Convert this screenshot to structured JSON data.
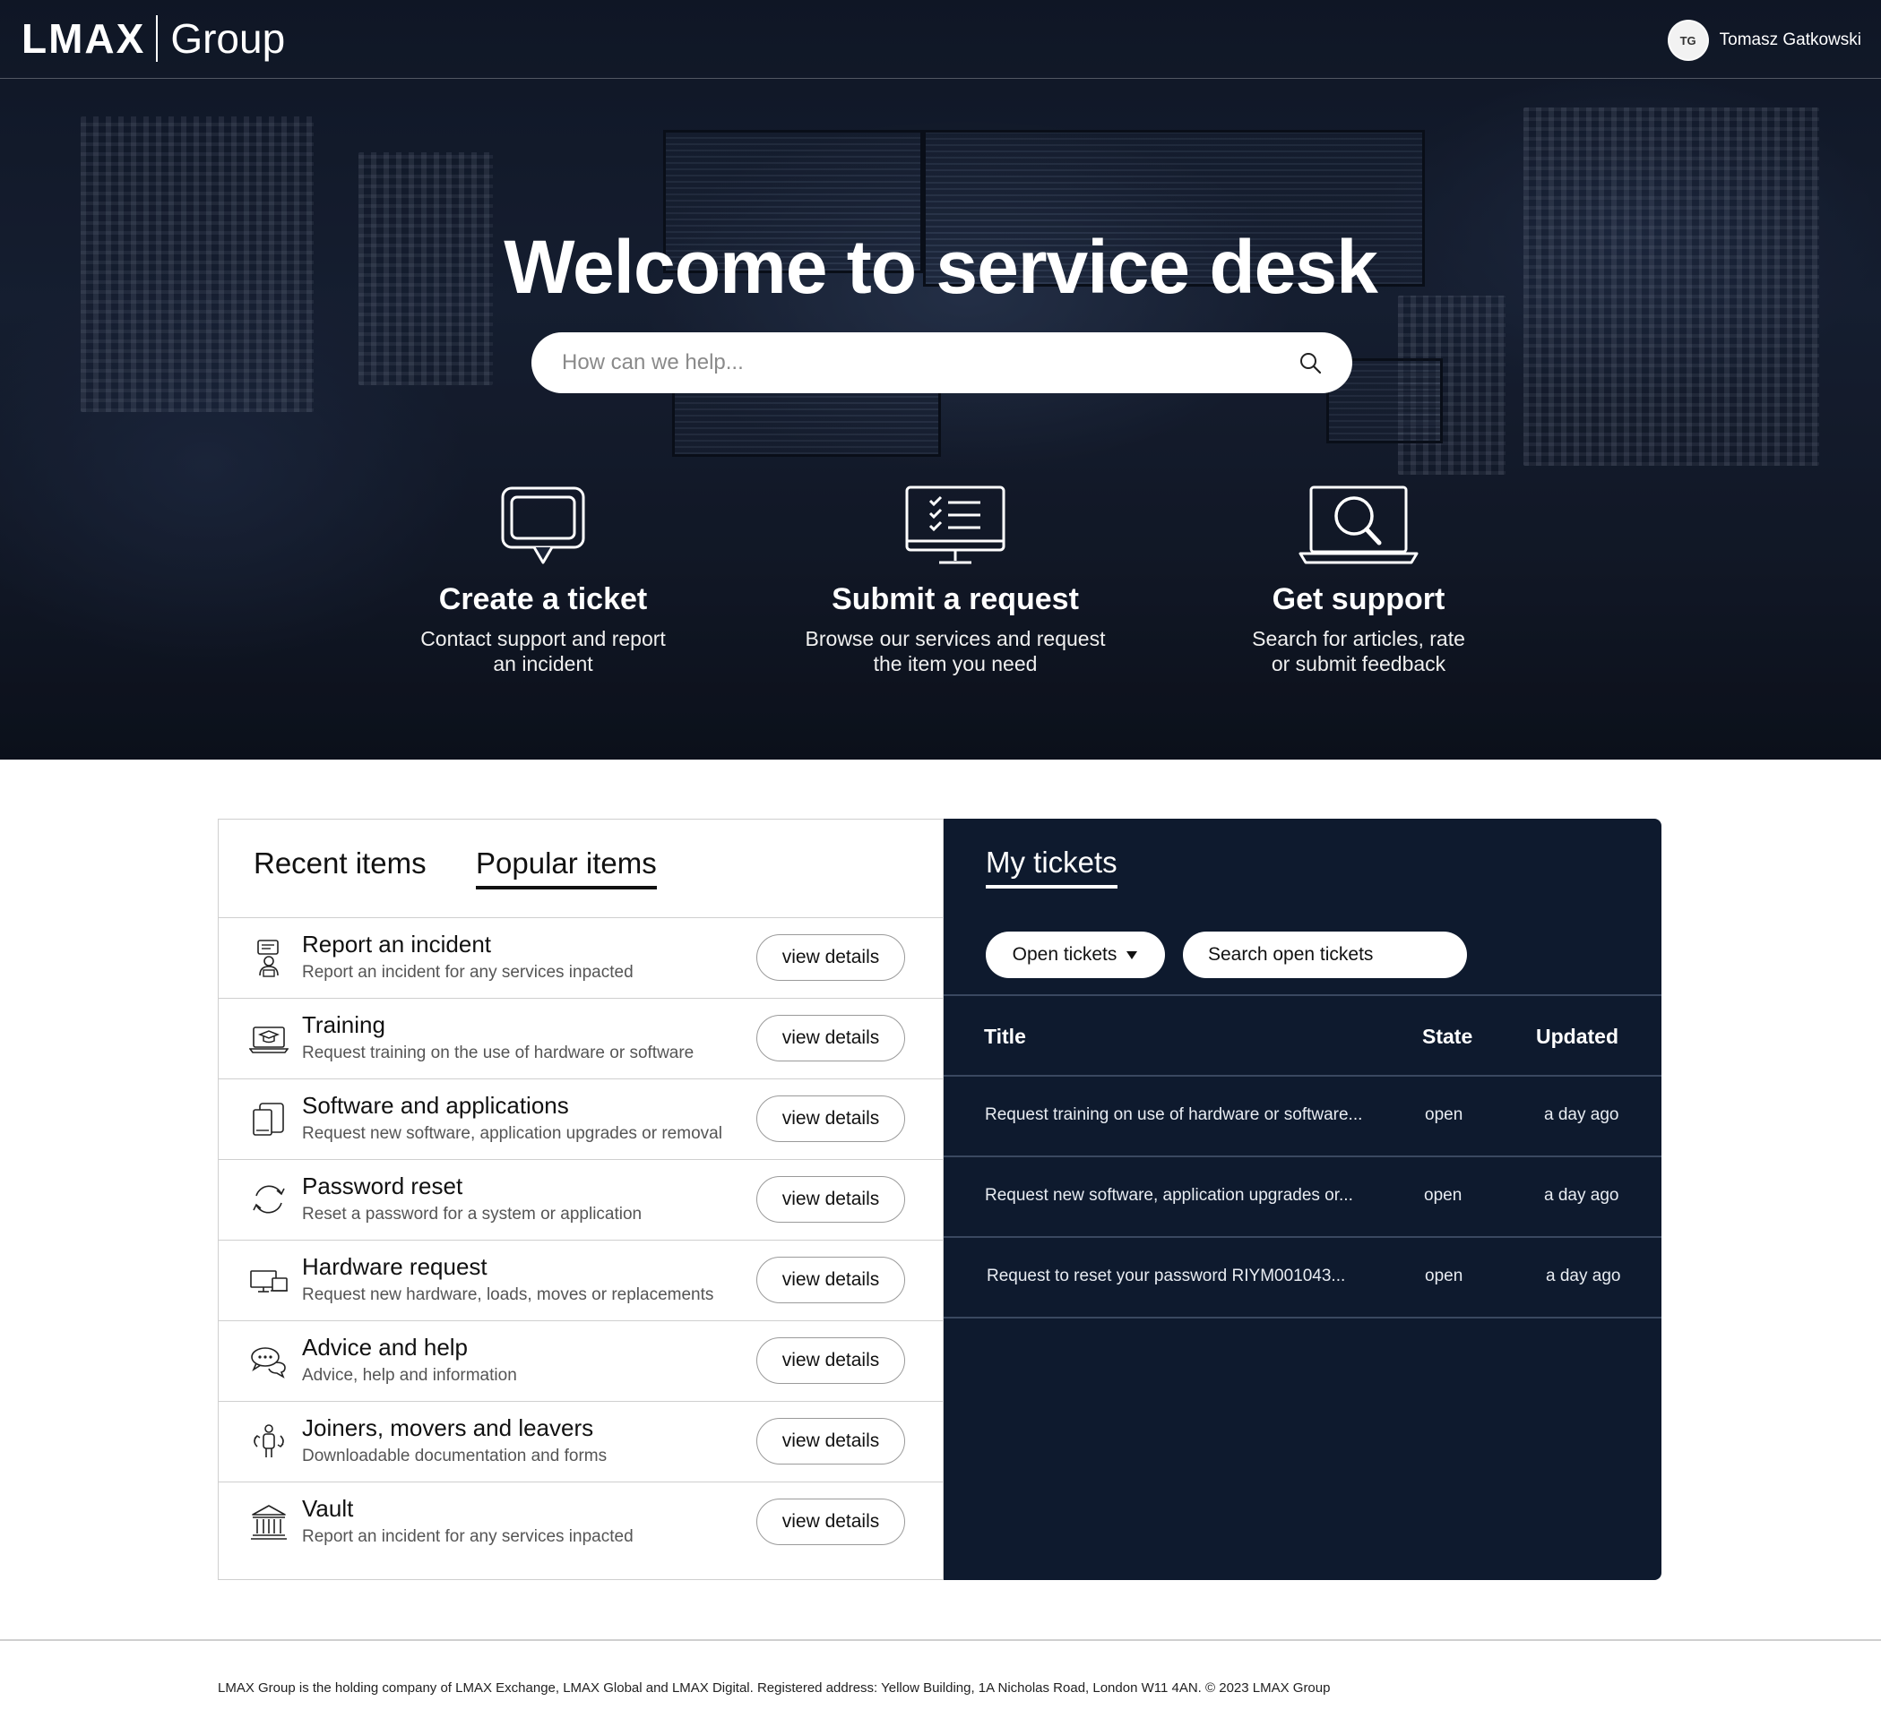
{
  "header": {
    "brand": "LMAX",
    "group": "Group",
    "user": {
      "initials": "TG",
      "name": "Tomasz Gatkowski"
    }
  },
  "hero": {
    "title": "Welcome to service desk",
    "search_placeholder": "How can we help...",
    "actions": [
      {
        "icon": "chat-bubble-icon",
        "title": "Create a ticket",
        "desc_line1": "Contact support and report",
        "desc_line2": "an incident"
      },
      {
        "icon": "checklist-monitor-icon",
        "title": "Submit a request",
        "desc_line1": "Browse our services and request",
        "desc_line2": "the item you need"
      },
      {
        "icon": "laptop-search-icon",
        "title": "Get support",
        "desc_line1": "Search for articles, rate",
        "desc_line2": "or submit feedback"
      }
    ]
  },
  "items_panel": {
    "tabs": [
      {
        "label": "Recent items",
        "active": false
      },
      {
        "label": "Popular items",
        "active": true
      }
    ],
    "button_label": "view details",
    "items": [
      {
        "icon": "incident-report-icon",
        "title": "Report an incident",
        "desc": "Report an incident for any services inpacted"
      },
      {
        "icon": "training-laptop-icon",
        "title": "Training",
        "desc": "Request training on the use of hardware or software"
      },
      {
        "icon": "software-devices-icon",
        "title": "Software and applications",
        "desc": "Request new software, application upgrades or removal"
      },
      {
        "icon": "refresh-icon",
        "title": "Password reset",
        "desc": "Reset a password for a system or application"
      },
      {
        "icon": "hardware-devices-icon",
        "title": "Hardware request",
        "desc": "Request new hardware, loads, moves or replacements"
      },
      {
        "icon": "chat-icon",
        "title": "Advice and help",
        "desc": "Advice, help and information"
      },
      {
        "icon": "person-movement-icon",
        "title": "Joiners, movers and leavers",
        "desc": "Downloadable documentation and forms"
      },
      {
        "icon": "bank-icon",
        "title": "Vault",
        "desc": "Report an incident for any services inpacted"
      }
    ]
  },
  "tickets_panel": {
    "title": "My tickets",
    "filter_label": "Open tickets",
    "search_placeholder": "Search open tickets",
    "columns": {
      "title": "Title",
      "state": "State",
      "updated": "Updated"
    },
    "rows": [
      {
        "title": "Request training on use of hardware or software...",
        "state": "open",
        "updated": "a day ago"
      },
      {
        "title": "Request new software, application upgrades or...",
        "state": "open",
        "updated": "a day ago"
      },
      {
        "title": "Request to reset your password RIYM001043...",
        "state": "open",
        "updated": "a day ago"
      }
    ]
  },
  "footer": {
    "text": "LMAX Group is the holding company of LMAX Exchange, LMAX Global and LMAX Digital. Registered address: Yellow Building, 1A Nicholas Road, London W11 4AN. © 2023 LMAX Group"
  },
  "colors": {
    "tickets_bg": "#0e1a2e",
    "hero_bg": "#1a2438",
    "accent": "#ffffff"
  }
}
